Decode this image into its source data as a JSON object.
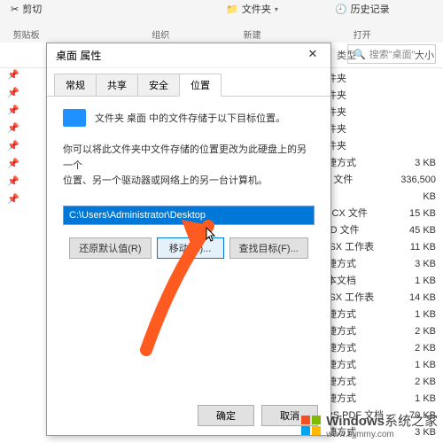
{
  "ribbon": {
    "groups": {
      "clipboard": {
        "cut": "剪切",
        "label": "剪贴板"
      },
      "organize": {
        "label": "组织"
      },
      "new": {
        "folder": "文件夹",
        "label": "新建"
      },
      "open": {
        "history": "历史记录",
        "label": "打开"
      }
    }
  },
  "explorer": {
    "search_placeholder": "搜索\"桌面\"",
    "columns": {
      "type": "类型",
      "size": "大小"
    },
    "files": [
      {
        "type": "文件夹",
        "size": ""
      },
      {
        "type": "文件夹",
        "size": ""
      },
      {
        "type": "文件夹",
        "size": ""
      },
      {
        "type": "文件夹",
        "size": ""
      },
      {
        "type": "文件夹",
        "size": ""
      },
      {
        "type": "快捷方式",
        "size": "3 KB"
      },
      {
        "type": "SD 文件",
        "size": "336,500 KB"
      },
      {
        "type": "DOCX 文件",
        "size": "15 KB"
      },
      {
        "type": "DFD 文件",
        "size": "45 KB"
      },
      {
        "type": "XLSX 工作表",
        "size": "11 KB"
      },
      {
        "type": "快捷方式",
        "size": "3 KB"
      },
      {
        "type": "文本文档",
        "size": "1 KB"
      },
      {
        "type": "XLSX 工作表",
        "size": "14 KB"
      },
      {
        "type": "快捷方式",
        "size": "1 KB"
      },
      {
        "type": "快捷方式",
        "size": "2 KB"
      },
      {
        "type": "快捷方式",
        "size": "2 KB"
      },
      {
        "type": "快捷方式",
        "size": "1 KB"
      },
      {
        "type": "快捷方式",
        "size": "2 KB"
      },
      {
        "type": "快捷方式",
        "size": "1 KB"
      },
      {
        "type": "WPS PDF 文档",
        "size": "70 KB"
      },
      {
        "type": "快捷方式",
        "size": "3 KB"
      }
    ]
  },
  "dialog": {
    "title": "桌面 属性",
    "tabs": {
      "general": "常规",
      "share": "共享",
      "security": "安全",
      "location": "位置"
    },
    "info_line": "文件夹 桌面 中的文件存储于以下目标位置。",
    "desc1": "你可以将此文件夹中文件存储的位置更改为此硬盘上的另一个",
    "desc2": "位置、另一个驱动器或网络上的另一台计算机。",
    "path_value": "C:\\Users\\Administrator\\Desktop",
    "buttons": {
      "restore": "还原默认值(R)",
      "move": "移动(M)...",
      "find": "查找目标(F)...",
      "ok": "确定",
      "cancel": "取消"
    }
  },
  "watermark": {
    "brand": "Windows",
    "suffix": "系统之家",
    "site": "www.bjjmmy.com"
  }
}
